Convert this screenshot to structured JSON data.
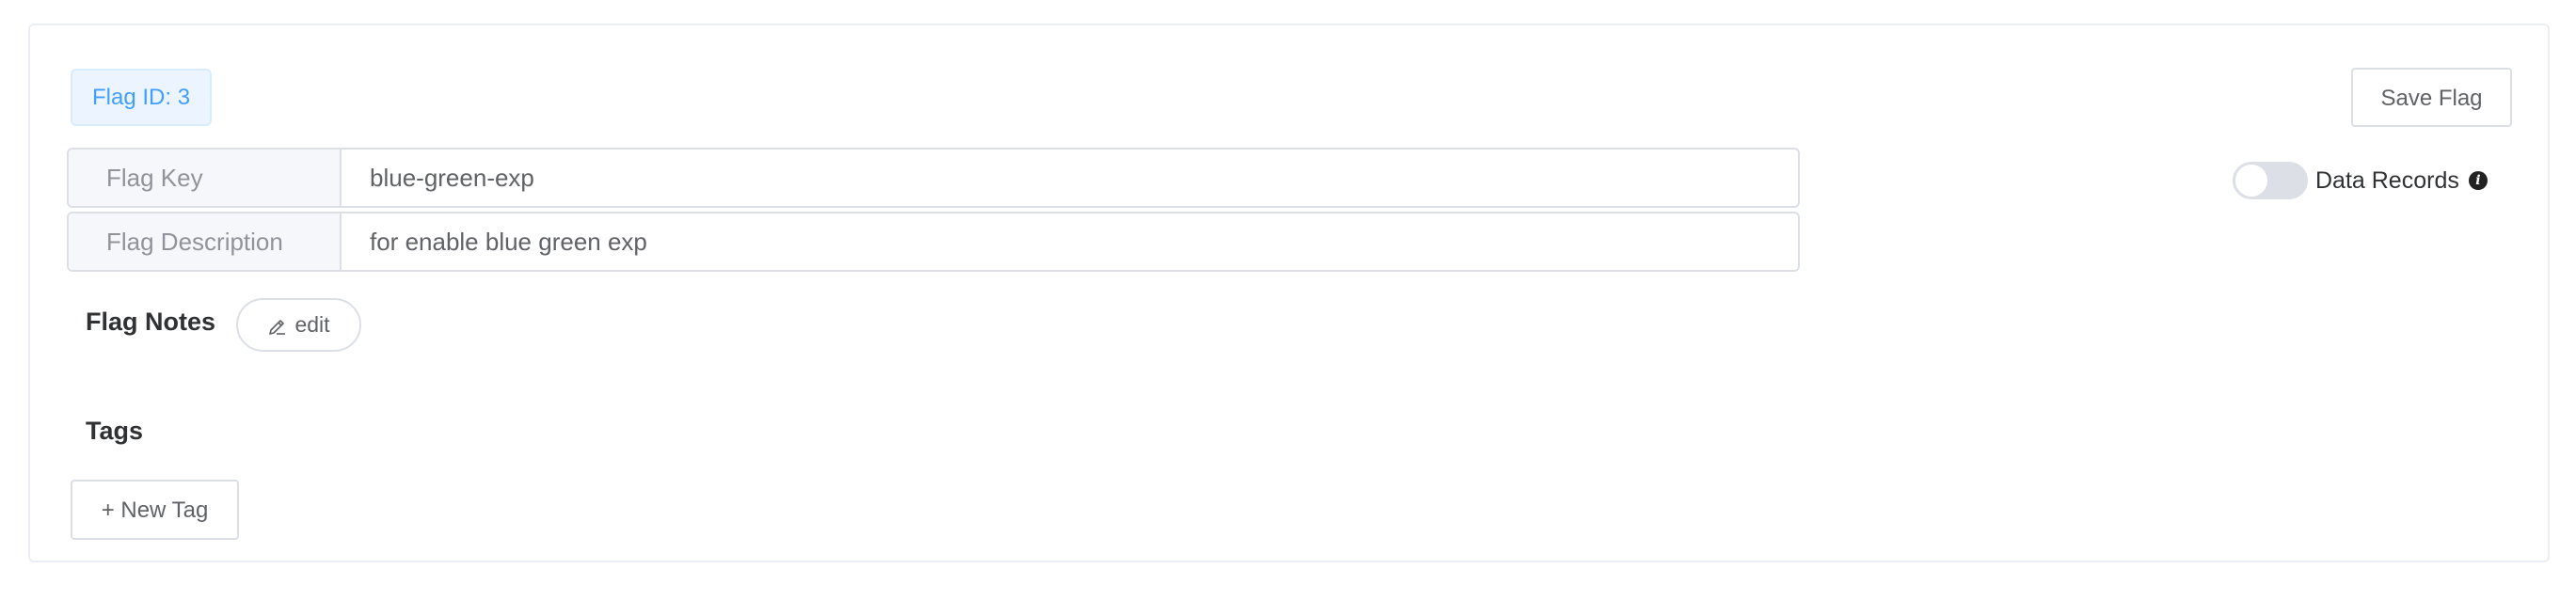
{
  "flag": {
    "id_label": "Flag ID: 3",
    "save_label": "Save Flag"
  },
  "fields": {
    "key_label": "Flag Key",
    "key_value": "blue-green-exp",
    "description_label": "Flag Description",
    "description_value": "for enable blue green exp"
  },
  "data_records": {
    "label": "Data Records",
    "enabled": false,
    "info_icon": "info-icon"
  },
  "notes": {
    "title": "Flag Notes",
    "edit_label": "edit",
    "edit_icon": "pencil-icon"
  },
  "tags": {
    "title": "Tags",
    "new_tag_label": "+ New Tag"
  },
  "colors": {
    "accent": "#409eff",
    "badge_bg": "#ecf5ff",
    "border": "#dcdfe6",
    "toggle_off": "#dcdfe6"
  }
}
